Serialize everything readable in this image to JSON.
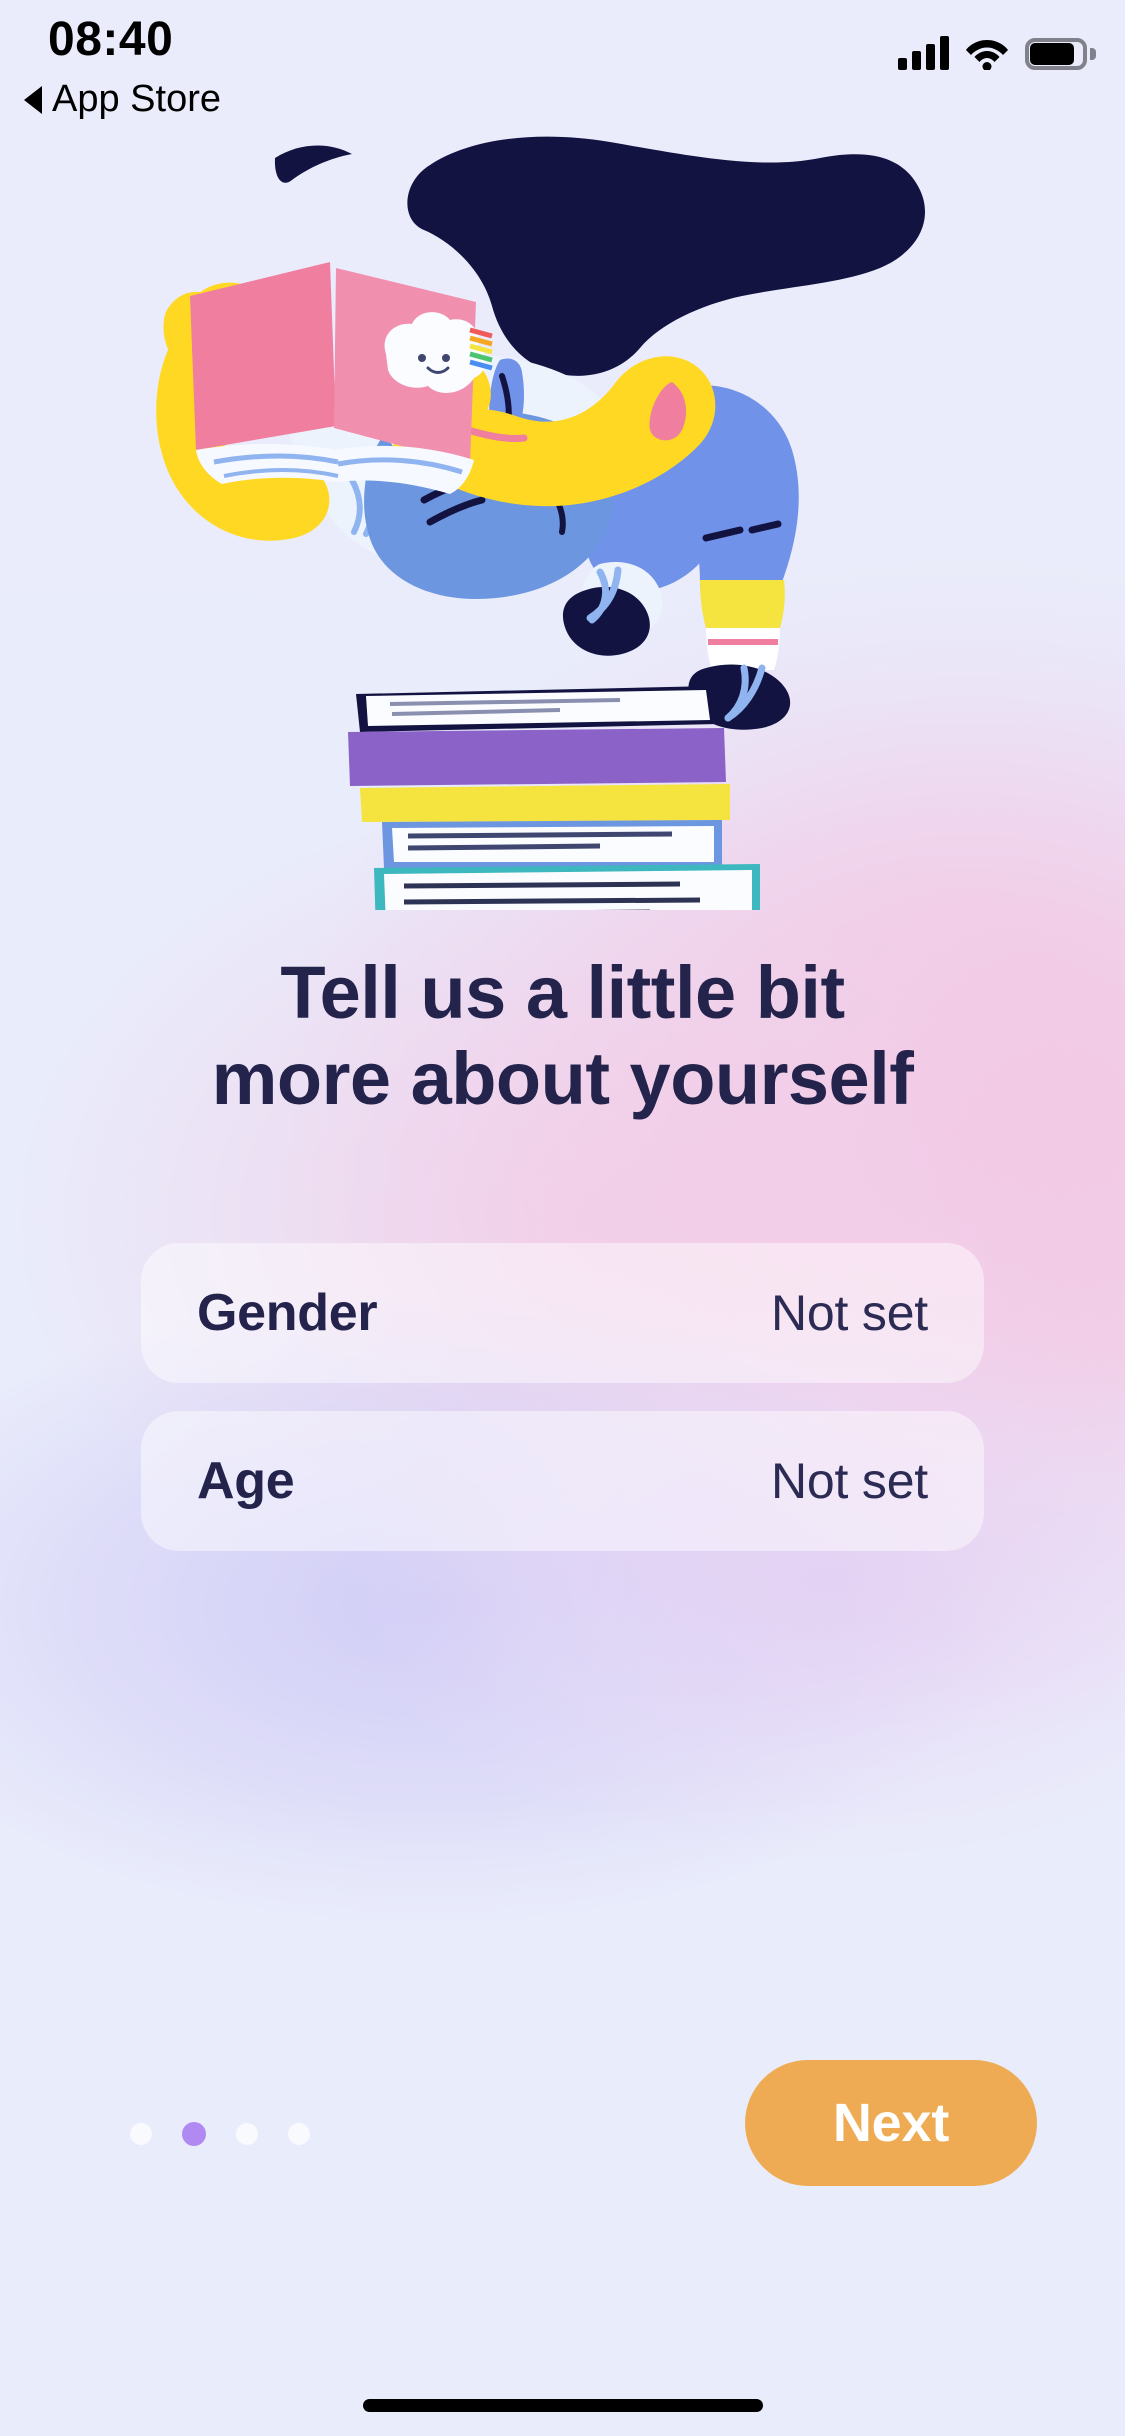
{
  "status_bar": {
    "time": "08:40",
    "back_label": "App Store",
    "back_icon": "triangle-left-icon",
    "cellular_icon": "cellular-signal-icon",
    "wifi_icon": "wifi-icon",
    "battery_icon": "battery-full-icon"
  },
  "illustration": {
    "name": "person-reading-book-on-stack-of-books",
    "book_cover_color": "#ef7e9f",
    "hair_color": "#131342",
    "skin_color": "#ffd823",
    "overalls_color": "#7092e8",
    "shirt_color": "#edf3fd",
    "books": [
      {
        "color": "#131342",
        "label": "book-navy"
      },
      {
        "color": "#8b63c8",
        "label": "book-purple"
      },
      {
        "color": "#f5e33f",
        "label": "book-yellow"
      },
      {
        "color": "#6c96e0",
        "label": "book-blue"
      },
      {
        "color": "#3db8bf",
        "label": "book-teal"
      }
    ]
  },
  "heading": {
    "line1": "Tell us a little bit",
    "line2": "more about yourself",
    "color": "#23234c"
  },
  "fields": [
    {
      "label": "Gender",
      "value": "Not set",
      "name": "gender"
    },
    {
      "label": "Age",
      "value": "Not set",
      "name": "age"
    }
  ],
  "pagination": {
    "total": 4,
    "active_index": 1,
    "active_color": "#b189f2",
    "inactive_color": "#ffffff"
  },
  "next_button": {
    "label": "Next",
    "background": "#eeab54",
    "text_color": "#ffffff"
  },
  "theme": {
    "background_lavender": "#e9ecfb",
    "background_pink": "#f3c9e5",
    "background_violet": "#cfcbf6",
    "text_dark": "#23234c"
  }
}
